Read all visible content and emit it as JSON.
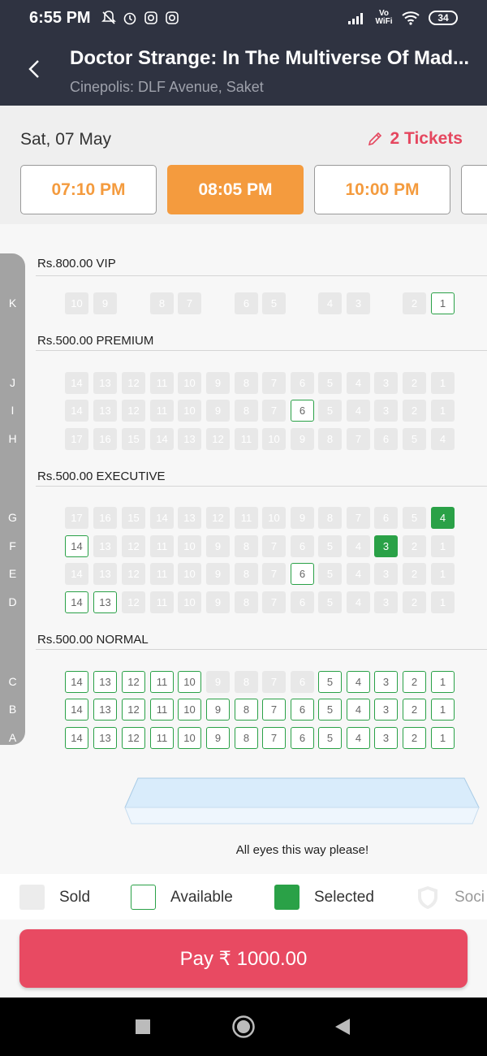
{
  "status_bar": {
    "time": "6:55 PM",
    "network": "Vo WiFi",
    "battery": "34"
  },
  "header": {
    "title": "Doctor Strange: In The Multiverse Of Mad...",
    "subtitle": "Cinepolis: DLF Avenue, Saket"
  },
  "date_row": {
    "date": "Sat, 07 May",
    "tickets": "2 Tickets"
  },
  "showtimes": [
    {
      "label": "07:10 PM",
      "active": false
    },
    {
      "label": "08:05 PM",
      "active": true
    },
    {
      "label": "10:00 PM",
      "active": false
    },
    {
      "label": "",
      "active": false
    }
  ],
  "sections": [
    {
      "label": "Rs.800.00  VIP"
    },
    {
      "label": "Rs.500.00  PREMIUM"
    },
    {
      "label": "Rs.500.00  EXECUTIVE"
    },
    {
      "label": "Rs.500.00  NORMAL"
    }
  ],
  "rows": [
    {
      "row": "K",
      "section": 0,
      "seats": [
        [
          "10",
          "sold"
        ],
        [
          "9",
          "sold"
        ],
        null,
        [
          "8",
          "sold"
        ],
        [
          "7",
          "sold"
        ],
        null,
        [
          "6",
          "sold"
        ],
        [
          "5",
          "sold"
        ],
        null,
        [
          "4",
          "sold"
        ],
        [
          "3",
          "sold"
        ],
        null,
        [
          "2",
          "sold"
        ],
        [
          "1",
          "avail"
        ]
      ]
    },
    {
      "row": "J",
      "section": 1,
      "seats": [
        [
          "14",
          "sold"
        ],
        [
          "13",
          "sold"
        ],
        [
          "12",
          "sold"
        ],
        [
          "11",
          "sold"
        ],
        [
          "10",
          "sold"
        ],
        [
          "9",
          "sold"
        ],
        [
          "8",
          "sold"
        ],
        [
          "7",
          "sold"
        ],
        [
          "6",
          "sold"
        ],
        [
          "5",
          "sold"
        ],
        [
          "4",
          "sold"
        ],
        [
          "3",
          "sold"
        ],
        [
          "2",
          "sold"
        ],
        [
          "1",
          "sold"
        ]
      ]
    },
    {
      "row": "I",
      "section": 1,
      "seats": [
        [
          "14",
          "sold"
        ],
        [
          "13",
          "sold"
        ],
        [
          "12",
          "sold"
        ],
        [
          "11",
          "sold"
        ],
        [
          "10",
          "sold"
        ],
        [
          "9",
          "sold"
        ],
        [
          "8",
          "sold"
        ],
        [
          "7",
          "sold"
        ],
        [
          "6",
          "avail"
        ],
        [
          "5",
          "sold"
        ],
        [
          "4",
          "sold"
        ],
        [
          "3",
          "sold"
        ],
        [
          "2",
          "sold"
        ],
        [
          "1",
          "sold"
        ]
      ]
    },
    {
      "row": "H",
      "section": 1,
      "seats": [
        [
          "17",
          "sold"
        ],
        [
          "16",
          "sold"
        ],
        [
          "15",
          "sold"
        ],
        [
          "14",
          "sold"
        ],
        [
          "13",
          "sold"
        ],
        [
          "12",
          "sold"
        ],
        [
          "11",
          "sold"
        ],
        [
          "10",
          "sold"
        ],
        [
          "9",
          "sold"
        ],
        [
          "8",
          "sold"
        ],
        [
          "7",
          "sold"
        ],
        [
          "6",
          "sold"
        ],
        [
          "5",
          "sold"
        ],
        [
          "4",
          "sold"
        ]
      ]
    },
    {
      "row": "G",
      "section": 2,
      "seats": [
        [
          "17",
          "sold"
        ],
        [
          "16",
          "sold"
        ],
        [
          "15",
          "sold"
        ],
        [
          "14",
          "sold"
        ],
        [
          "13",
          "sold"
        ],
        [
          "12",
          "sold"
        ],
        [
          "11",
          "sold"
        ],
        [
          "10",
          "sold"
        ],
        [
          "9",
          "sold"
        ],
        [
          "8",
          "sold"
        ],
        [
          "7",
          "sold"
        ],
        [
          "6",
          "sold"
        ],
        [
          "5",
          "sold"
        ],
        [
          "4",
          "sel"
        ]
      ]
    },
    {
      "row": "F",
      "section": 2,
      "seats": [
        [
          "14",
          "avail"
        ],
        [
          "13",
          "sold"
        ],
        [
          "12",
          "sold"
        ],
        [
          "11",
          "sold"
        ],
        [
          "10",
          "sold"
        ],
        [
          "9",
          "sold"
        ],
        [
          "8",
          "sold"
        ],
        [
          "7",
          "sold"
        ],
        [
          "6",
          "sold"
        ],
        [
          "5",
          "sold"
        ],
        [
          "4",
          "sold"
        ],
        [
          "3",
          "sel"
        ],
        [
          "2",
          "sold"
        ],
        [
          "1",
          "sold"
        ]
      ]
    },
    {
      "row": "E",
      "section": 2,
      "seats": [
        [
          "14",
          "sold"
        ],
        [
          "13",
          "sold"
        ],
        [
          "12",
          "sold"
        ],
        [
          "11",
          "sold"
        ],
        [
          "10",
          "sold"
        ],
        [
          "9",
          "sold"
        ],
        [
          "8",
          "sold"
        ],
        [
          "7",
          "sold"
        ],
        [
          "6",
          "avail"
        ],
        [
          "5",
          "sold"
        ],
        [
          "4",
          "sold"
        ],
        [
          "3",
          "sold"
        ],
        [
          "2",
          "sold"
        ],
        [
          "1",
          "sold"
        ]
      ]
    },
    {
      "row": "D",
      "section": 2,
      "seats": [
        [
          "14",
          "avail"
        ],
        [
          "13",
          "avail"
        ],
        [
          "12",
          "sold"
        ],
        [
          "11",
          "sold"
        ],
        [
          "10",
          "sold"
        ],
        [
          "9",
          "sold"
        ],
        [
          "8",
          "sold"
        ],
        [
          "7",
          "sold"
        ],
        [
          "6",
          "sold"
        ],
        [
          "5",
          "sold"
        ],
        [
          "4",
          "sold"
        ],
        [
          "3",
          "sold"
        ],
        [
          "2",
          "sold"
        ],
        [
          "1",
          "sold"
        ]
      ]
    },
    {
      "row": "C",
      "section": 3,
      "seats": [
        [
          "14",
          "avail"
        ],
        [
          "13",
          "avail"
        ],
        [
          "12",
          "avail"
        ],
        [
          "11",
          "avail"
        ],
        [
          "10",
          "avail"
        ],
        [
          "9",
          "sold"
        ],
        [
          "8",
          "sold"
        ],
        [
          "7",
          "sold"
        ],
        [
          "6",
          "sold"
        ],
        [
          "5",
          "avail"
        ],
        [
          "4",
          "avail"
        ],
        [
          "3",
          "avail"
        ],
        [
          "2",
          "avail"
        ],
        [
          "1",
          "avail"
        ]
      ]
    },
    {
      "row": "B",
      "section": 3,
      "seats": [
        [
          "14",
          "avail"
        ],
        [
          "13",
          "avail"
        ],
        [
          "12",
          "avail"
        ],
        [
          "11",
          "avail"
        ],
        [
          "10",
          "avail"
        ],
        [
          "9",
          "avail"
        ],
        [
          "8",
          "avail"
        ],
        [
          "7",
          "avail"
        ],
        [
          "6",
          "avail"
        ],
        [
          "5",
          "avail"
        ],
        [
          "4",
          "avail"
        ],
        [
          "3",
          "avail"
        ],
        [
          "2",
          "avail"
        ],
        [
          "1",
          "avail"
        ]
      ]
    },
    {
      "row": "A",
      "section": 3,
      "seats": [
        [
          "14",
          "avail"
        ],
        [
          "13",
          "avail"
        ],
        [
          "12",
          "avail"
        ],
        [
          "11",
          "avail"
        ],
        [
          "10",
          "avail"
        ],
        [
          "9",
          "avail"
        ],
        [
          "8",
          "avail"
        ],
        [
          "7",
          "avail"
        ],
        [
          "6",
          "avail"
        ],
        [
          "5",
          "avail"
        ],
        [
          "4",
          "avail"
        ],
        [
          "3",
          "avail"
        ],
        [
          "2",
          "avail"
        ],
        [
          "1",
          "avail"
        ]
      ]
    }
  ],
  "screen_text": "All eyes this way please!",
  "legend": {
    "sold": "Sold",
    "available": "Available",
    "selected": "Selected",
    "social": "Soci"
  },
  "pay_button": "Pay ₹ 1000.00",
  "colors": {
    "header_bg": "#2f3341",
    "accent_orange": "#f49b3e",
    "accent_red": "#e84a62",
    "seat_green": "#2aa147",
    "seat_sold": "#e8e8e8"
  },
  "icons": [
    "bell-off-icon",
    "alarm-icon",
    "instagram-icon",
    "signal-icon",
    "wifi-icon",
    "back-arrow-icon",
    "pencil-icon",
    "home-icon",
    "back-icon",
    "recents-icon"
  ]
}
